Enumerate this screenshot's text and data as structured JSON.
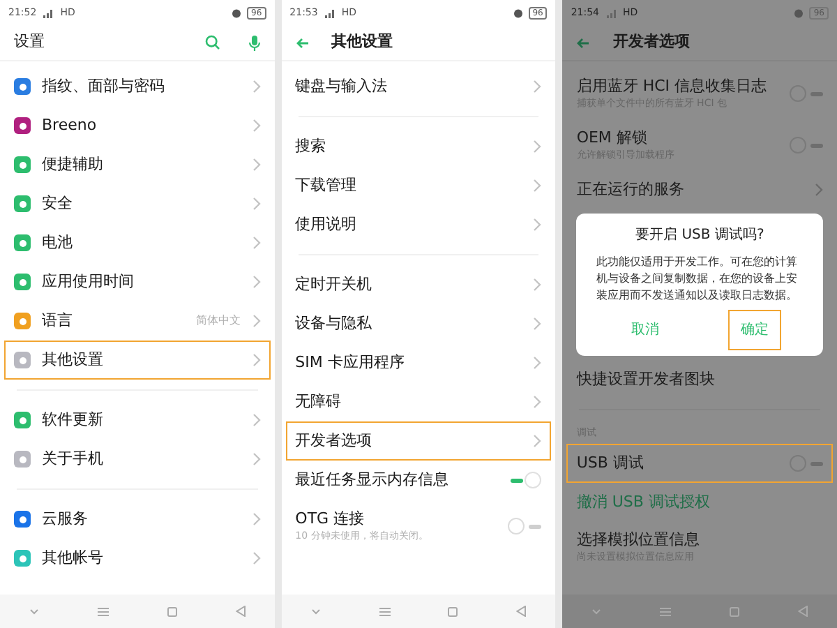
{
  "panels": [
    {
      "status": {
        "time": "21:52",
        "network": "HD",
        "battery": "96"
      },
      "header": {
        "title": "设置",
        "back": false,
        "search": true,
        "voice": true
      },
      "dimmed": false,
      "groups": [
        {
          "items": [
            {
              "kind": "link",
              "label": "指纹、面部与密码",
              "color": "#2a7de1",
              "highlighted": false
            },
            {
              "kind": "link",
              "label": "Breeno",
              "color": "#b0207f",
              "highlighted": false
            },
            {
              "kind": "link",
              "label": "便捷辅助",
              "color": "#2dbd6e",
              "highlighted": false
            },
            {
              "kind": "link",
              "label": "安全",
              "color": "#2dbd6e",
              "highlighted": false
            },
            {
              "kind": "link",
              "label": "电池",
              "color": "#2dbd6e",
              "highlighted": false
            },
            {
              "kind": "link",
              "label": "应用使用时间",
              "color": "#2dbd6e",
              "highlighted": false
            },
            {
              "kind": "link",
              "label": "语言",
              "value": "简体中文",
              "color": "#f0a020",
              "highlighted": false
            },
            {
              "kind": "link",
              "label": "其他设置",
              "color": "#b8b8c0",
              "highlighted": true
            }
          ]
        },
        {
          "items": [
            {
              "kind": "link",
              "label": "软件更新",
              "color": "#2dbd6e",
              "highlighted": false
            },
            {
              "kind": "link",
              "label": "关于手机",
              "color": "#b8b8c0",
              "highlighted": false
            }
          ]
        },
        {
          "items": [
            {
              "kind": "link",
              "label": "云服务",
              "color": "#1a73e8",
              "highlighted": false
            },
            {
              "kind": "link",
              "label": "其他帐号",
              "color": "#2cc4b8",
              "highlighted": false
            }
          ]
        }
      ]
    },
    {
      "status": {
        "time": "21:53",
        "network": "HD",
        "battery": "96"
      },
      "header": {
        "title": "其他设置",
        "back": true,
        "search": false,
        "voice": false
      },
      "dimmed": false,
      "groups": [
        {
          "items": [
            {
              "kind": "link",
              "label": "键盘与输入法",
              "highlighted": false
            }
          ]
        },
        {
          "items": [
            {
              "kind": "link",
              "label": "搜索",
              "highlighted": false
            },
            {
              "kind": "link",
              "label": "下载管理",
              "highlighted": false
            },
            {
              "kind": "link",
              "label": "使用说明",
              "highlighted": false
            }
          ]
        },
        {
          "items": [
            {
              "kind": "link",
              "label": "定时开关机",
              "highlighted": false
            },
            {
              "kind": "link",
              "label": "设备与隐私",
              "highlighted": false
            },
            {
              "kind": "link",
              "label": "SIM 卡应用程序",
              "highlighted": false
            },
            {
              "kind": "link",
              "label": "无障碍",
              "highlighted": false
            },
            {
              "kind": "link",
              "label": "开发者选项",
              "highlighted": true
            },
            {
              "kind": "toggle",
              "label": "最近任务显示内存信息",
              "on": true,
              "highlighted": false
            },
            {
              "kind": "toggle",
              "label": "OTG 连接",
              "subtitle": "10 分钟未使用，将自动关闭。",
              "on": false,
              "highlighted": false
            }
          ]
        }
      ]
    },
    {
      "status": {
        "time": "21:54",
        "network": "HD",
        "battery": "96"
      },
      "header": {
        "title": "开发者选项",
        "back": true,
        "search": false,
        "voice": false
      },
      "dimmed": true,
      "groups": [
        {
          "items": [
            {
              "kind": "toggle",
              "label": "启用蓝牙 HCI 信息收集日志",
              "subtitle": "捕获单个文件中的所有蓝牙 HCI 包",
              "on": false,
              "highlighted": false
            },
            {
              "kind": "toggle",
              "label": "OEM 解锁",
              "subtitle": "允许解锁引导加载程序",
              "on": false,
              "highlighted": false
            },
            {
              "kind": "link",
              "label": "正在运行的服务",
              "highlighted": false
            }
          ]
        },
        {
          "items": [
            {
              "kind": "plain",
              "label": "快捷设置开发者图块",
              "highlighted": false
            }
          ]
        },
        {
          "section": "调试",
          "items": [
            {
              "kind": "toggle",
              "label": "USB 调试",
              "on": false,
              "highlighted": true
            },
            {
              "kind": "action",
              "label": "撤消 USB 调试授权",
              "highlighted": false
            },
            {
              "kind": "plain",
              "label": "选择模拟位置信息",
              "subtitle": "尚未设置模拟位置信息应用",
              "highlighted": false
            }
          ]
        }
      ],
      "dialog": {
        "title": "要开启 USB 调试吗?",
        "message": "此功能仅适用于开发工作。可在您的计算机与设备之间复制数据，在您的设备上安装应用而不发送通知以及读取日志数据。",
        "buttons": [
          {
            "label": "取消",
            "highlighted": false
          },
          {
            "label": "确定",
            "highlighted": true
          }
        ]
      }
    }
  ]
}
